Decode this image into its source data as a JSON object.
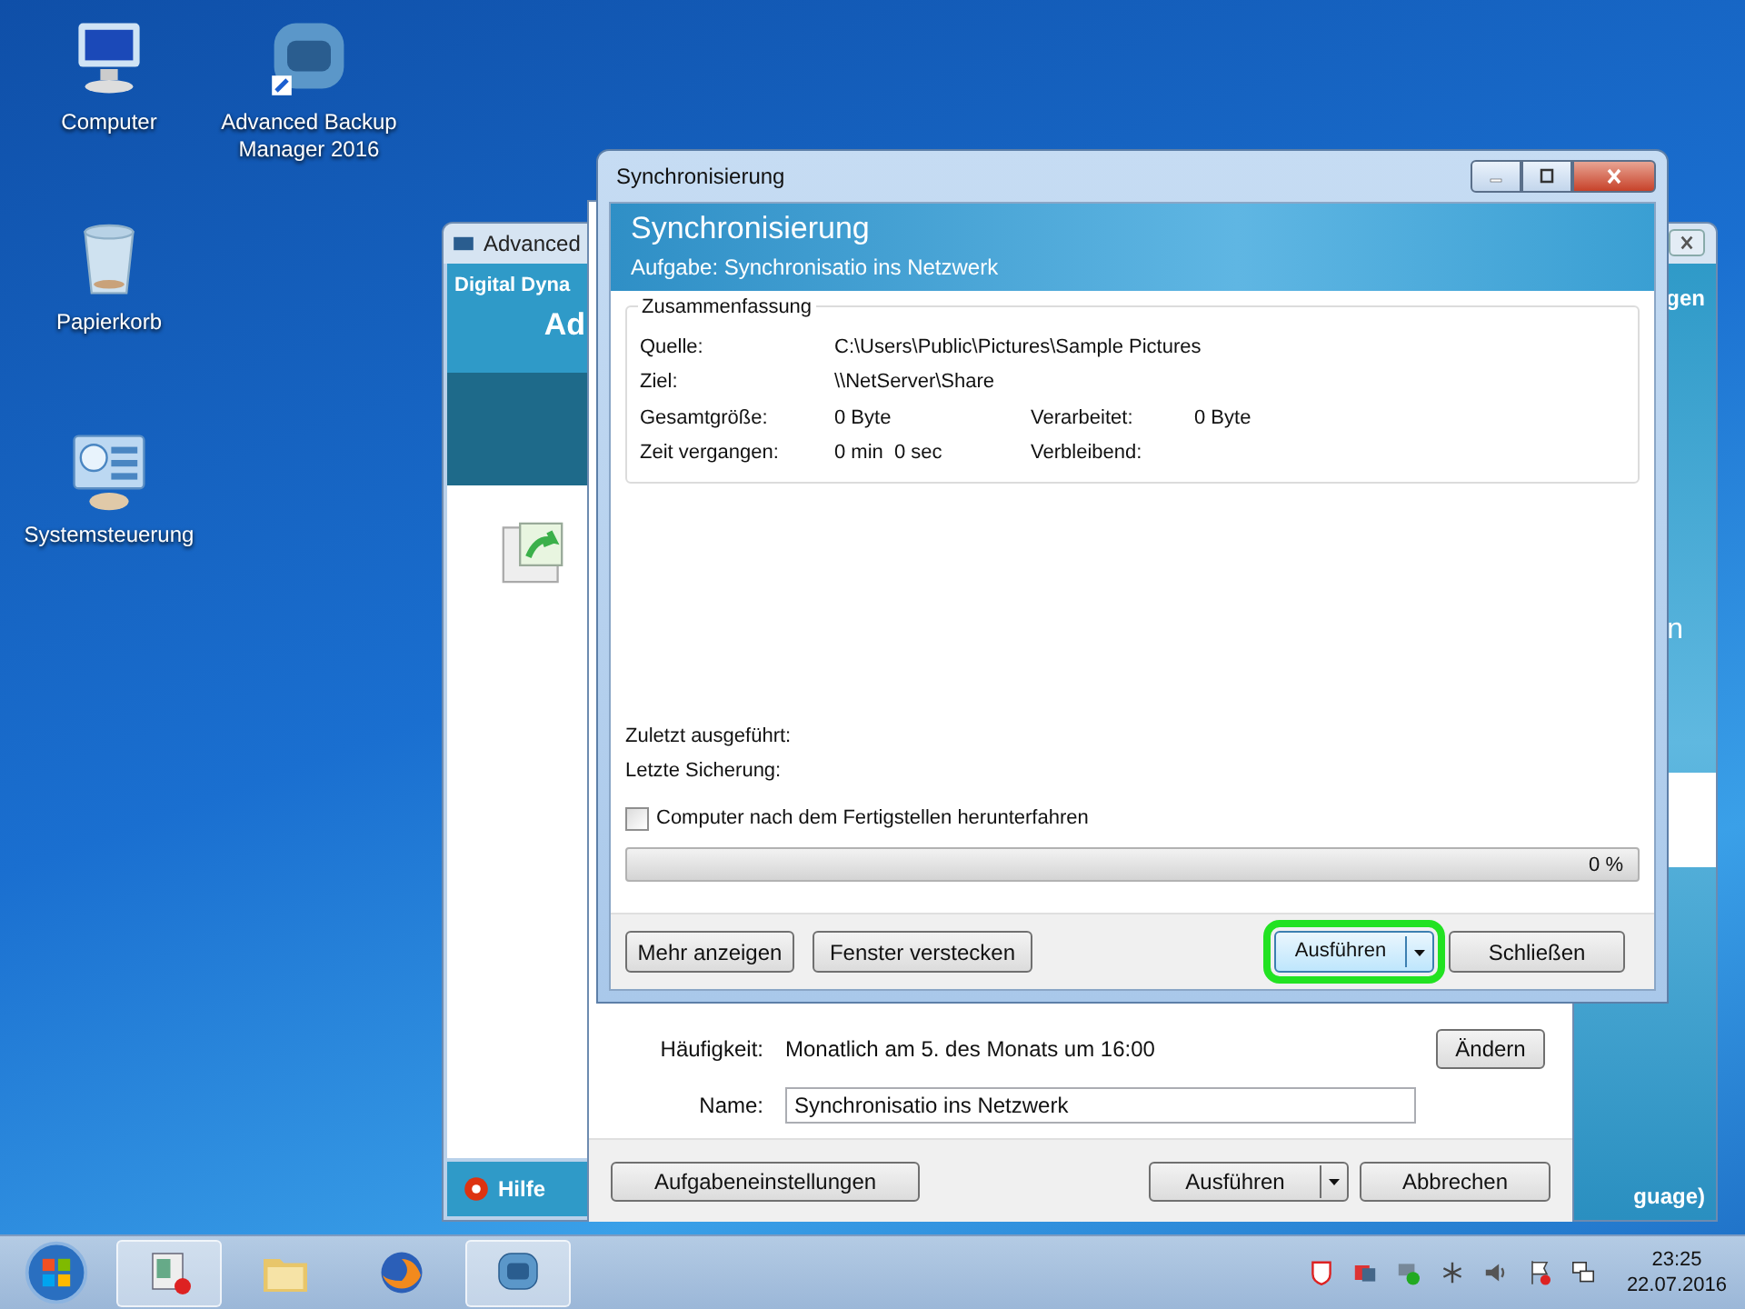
{
  "desktop_icons": [
    {
      "kind": "computer",
      "label": "Computer"
    },
    {
      "kind": "backup",
      "label": "Advanced Backup Manager 2016"
    },
    {
      "kind": "trash",
      "label": "Papierkorb"
    },
    {
      "kind": "control",
      "label": "Systemsteuerung"
    }
  ],
  "back_window": {
    "title": "Advanced",
    "header_line_1": "Digital Dyna",
    "header_line_2": "Ad",
    "right_fragment_1": "gen",
    "right_fragment_2": "n",
    "help_button": "Hilfe",
    "footer_fragment": "guage)"
  },
  "task_window": {
    "frequency_label": "Häufigkeit:",
    "frequency_value": "Monatlich am 5. des Monats um 16:00",
    "change_button": "Ändern",
    "name_label": "Name:",
    "name_value": "Synchronisatio ins Netzwerk",
    "settings_button": "Aufgabeneinstellungen",
    "run_button": "Ausführen",
    "cancel_button": "Abbrechen"
  },
  "dialog": {
    "title": "Synchronisierung",
    "header_title": "Synchronisierung",
    "header_subtitle": "Aufgabe: Synchronisatio ins Netzwerk",
    "group_title": "Zusammenfassung",
    "summary_rows": [
      {
        "label": "Quelle:",
        "value": "C:\\Users\\Public\\Pictures\\Sample Pictures"
      },
      {
        "label": "Ziel:",
        "value": "\\\\NetServer\\Share"
      },
      {
        "label": "Gesamtgröße:",
        "value": "0 Byte",
        "label_2": "Verarbeitet:",
        "value_2": "0 Byte"
      },
      {
        "label": "Zeit vergangen:",
        "value": "0 min  0 sec",
        "label_2": "Verbleibend:"
      }
    ],
    "last_run_label": "Zuletzt ausgeführt:",
    "last_backup_label": "Letzte Sicherung:",
    "shutdown_checkbox": {
      "label": "Computer nach dem Fertigstellen herunterfahren",
      "checked": false
    },
    "progress": {
      "level": 0,
      "reading": "0 %"
    },
    "more_button": "Mehr anzeigen",
    "hide_button": "Fenster verstecken",
    "run_button": {
      "label": "Ausführen",
      "highlighted": true
    },
    "close_button": "Schließen"
  },
  "taskbar": {
    "apps": [
      {
        "kind": "recorder",
        "active": true
      },
      {
        "kind": "folder",
        "active": false
      },
      {
        "kind": "browser",
        "active": false
      },
      {
        "kind": "backup",
        "active": true
      }
    ],
    "time": "23:25",
    "date": "22.07.2016"
  }
}
